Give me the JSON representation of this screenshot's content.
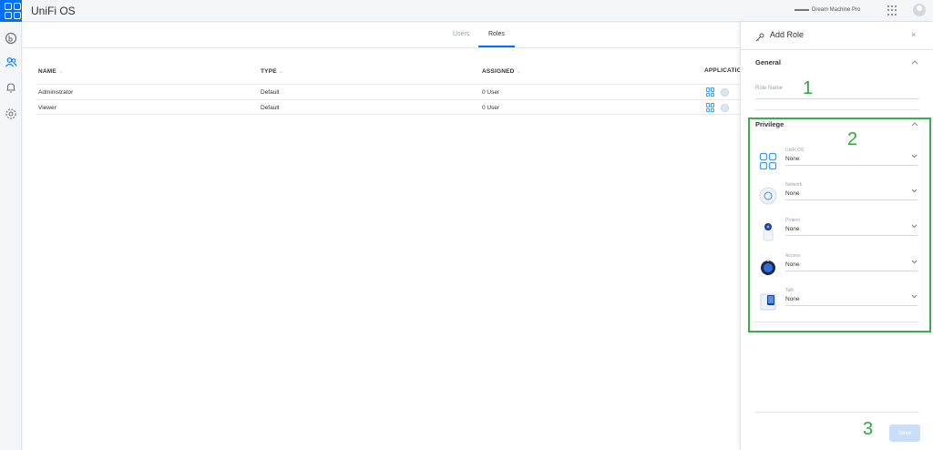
{
  "topbar": {
    "app_title": "UniFi OS",
    "device_name": "Dream Machine Pro"
  },
  "sidebar": {
    "items": [
      {
        "icon": "dashboard-icon"
      },
      {
        "icon": "users-icon"
      },
      {
        "icon": "bell-icon"
      },
      {
        "icon": "gear-icon"
      }
    ]
  },
  "tabs": [
    {
      "label": "Users",
      "active": false
    },
    {
      "label": "Roles",
      "active": true
    }
  ],
  "table": {
    "headers": [
      "NAME",
      "TYPE",
      "ASSIGNED",
      "APPLICATIO"
    ],
    "sort_glyph": "⌄",
    "rows": [
      {
        "name": "Administrator",
        "type": "Default",
        "assigned": "0 User"
      },
      {
        "name": "Viewer",
        "type": "Default",
        "assigned": "0 User"
      }
    ]
  },
  "panel": {
    "title": "Add Role",
    "close_glyph": "×",
    "general_title": "General",
    "role_name_label": "Role Name",
    "privilege_title": "Privilege",
    "privileges": [
      {
        "label": "UniFi OS",
        "value": "None",
        "icon": "unifi-os-icon"
      },
      {
        "label": "Network",
        "value": "None",
        "icon": "network-device-icon"
      },
      {
        "label": "Protect",
        "value": "None",
        "icon": "protect-camera-icon"
      },
      {
        "label": "Access",
        "value": "None",
        "icon": "access-reader-icon"
      },
      {
        "label": "Talk",
        "value": "None",
        "icon": "talk-phone-icon"
      }
    ],
    "save_label": "Save"
  },
  "annotations": {
    "one": "1",
    "two": "2",
    "three": "3"
  },
  "colors": {
    "accent": "#006fff",
    "annotation_green": "#2eaa3f",
    "save_disabled": "#c9def7"
  }
}
